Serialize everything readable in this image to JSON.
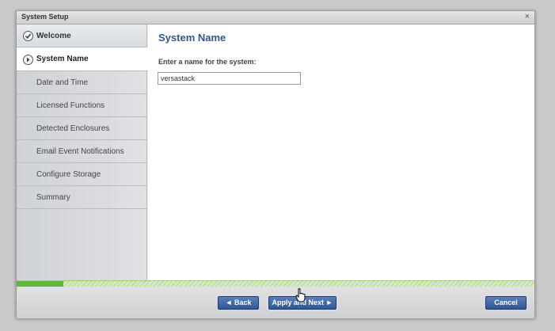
{
  "dialog": {
    "title": "System Setup",
    "close_glyph": "×"
  },
  "sidebar": {
    "items": [
      {
        "label": "Welcome",
        "state": "done",
        "icon": "check-circle-icon"
      },
      {
        "label": "System Name",
        "state": "active",
        "icon": "arrow-circle-icon"
      },
      {
        "label": "Date and Time",
        "state": "pending"
      },
      {
        "label": "Licensed Functions",
        "state": "pending"
      },
      {
        "label": "Detected Enclosures",
        "state": "pending"
      },
      {
        "label": "Email Event Notifications",
        "state": "pending"
      },
      {
        "label": "Configure Storage",
        "state": "pending"
      },
      {
        "label": "Summary",
        "state": "pending"
      }
    ]
  },
  "main": {
    "heading": "System Name",
    "field_label": "Enter a name for the system:",
    "system_name_value": "versastack"
  },
  "progress": {
    "fraction": 0.09,
    "fill_color": "#5fb83a"
  },
  "footer": {
    "back_label": "◄ Back",
    "next_label": "Apply and Next ►",
    "cancel_label": "Cancel"
  },
  "colors": {
    "heading": "#33558d",
    "button": "#2f5799"
  }
}
